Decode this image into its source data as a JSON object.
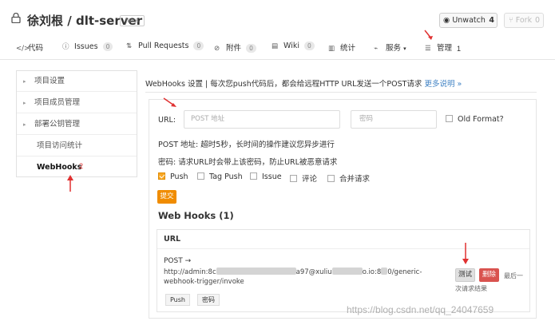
{
  "repo": {
    "owner": "徐刘根",
    "separator": "/",
    "name": "dlt-server",
    "language": "Java"
  },
  "watch": {
    "label": "Unwatch",
    "count": "4"
  },
  "fork": {
    "label": "Fork",
    "count": "0"
  },
  "nav": [
    {
      "icon": "</>",
      "label": "代码",
      "count": ""
    },
    {
      "icon": "ⓘ",
      "label": "Issues",
      "count": "0"
    },
    {
      "icon": "⇅",
      "label": "Pull Requests",
      "count": "0"
    },
    {
      "icon": "⊘",
      "label": "附件",
      "count": "0"
    },
    {
      "icon": "▤",
      "label": "Wiki",
      "count": "0"
    },
    {
      "icon": "▥",
      "label": "统计",
      "count": ""
    },
    {
      "icon": "⌁",
      "label": "服务",
      "count": ""
    },
    {
      "icon": "☰",
      "label": "管理",
      "count": ""
    }
  ],
  "annotations": {
    "manage": "1",
    "webhooks": "2"
  },
  "sidebar": [
    {
      "label": "项目设置"
    },
    {
      "label": "项目成员管理"
    },
    {
      "label": "部署公钥管理"
    },
    {
      "label": "项目访问统计"
    },
    {
      "label": "WebHooks"
    }
  ],
  "header": {
    "text": "WebHooks 设置 | 每次您push代码后，都会给远程HTTP URL发送一个POST请求",
    "link": "更多说明 »"
  },
  "form": {
    "url_label": "URL:",
    "url_placeholder": "POST 地址",
    "password_placeholder": "密码",
    "old_format_label": "Old Format?",
    "note1": "POST 地址: 超时5秒，长时间的操作建议您异步进行",
    "note2": "密码: 请求URL时会带上该密码，防止URL被恶意请求",
    "events": [
      {
        "label": "Push",
        "checked": true
      },
      {
        "label": "Tag Push",
        "checked": false
      },
      {
        "label": "Issue",
        "checked": false
      },
      {
        "label": "评论",
        "checked": false
      },
      {
        "label": "合并请求",
        "checked": false
      }
    ],
    "submit_label": "提交"
  },
  "hooks": {
    "title": "Web Hooks (1)",
    "column_header": "URL",
    "items": [
      {
        "method": "POST →",
        "url_start": "http://admin:8c",
        "url_mid1": "a97@xuliu",
        "url_mid2": "o.io:8",
        "url_end": "0/generic-",
        "url_line2": "webhook-trigger/invoke",
        "tags": [
          "Push",
          "密码"
        ],
        "test_label": "测试",
        "delete_label": "删除",
        "last_label": "最后一",
        "last_result": "次请求结果"
      }
    ]
  },
  "watermark": "https://blog.csdn.net/qq_24047659",
  "colors": {
    "accent": "#f08c00",
    "danger": "#d9534f",
    "link": "#4183c4",
    "annotation": "#e03030"
  }
}
